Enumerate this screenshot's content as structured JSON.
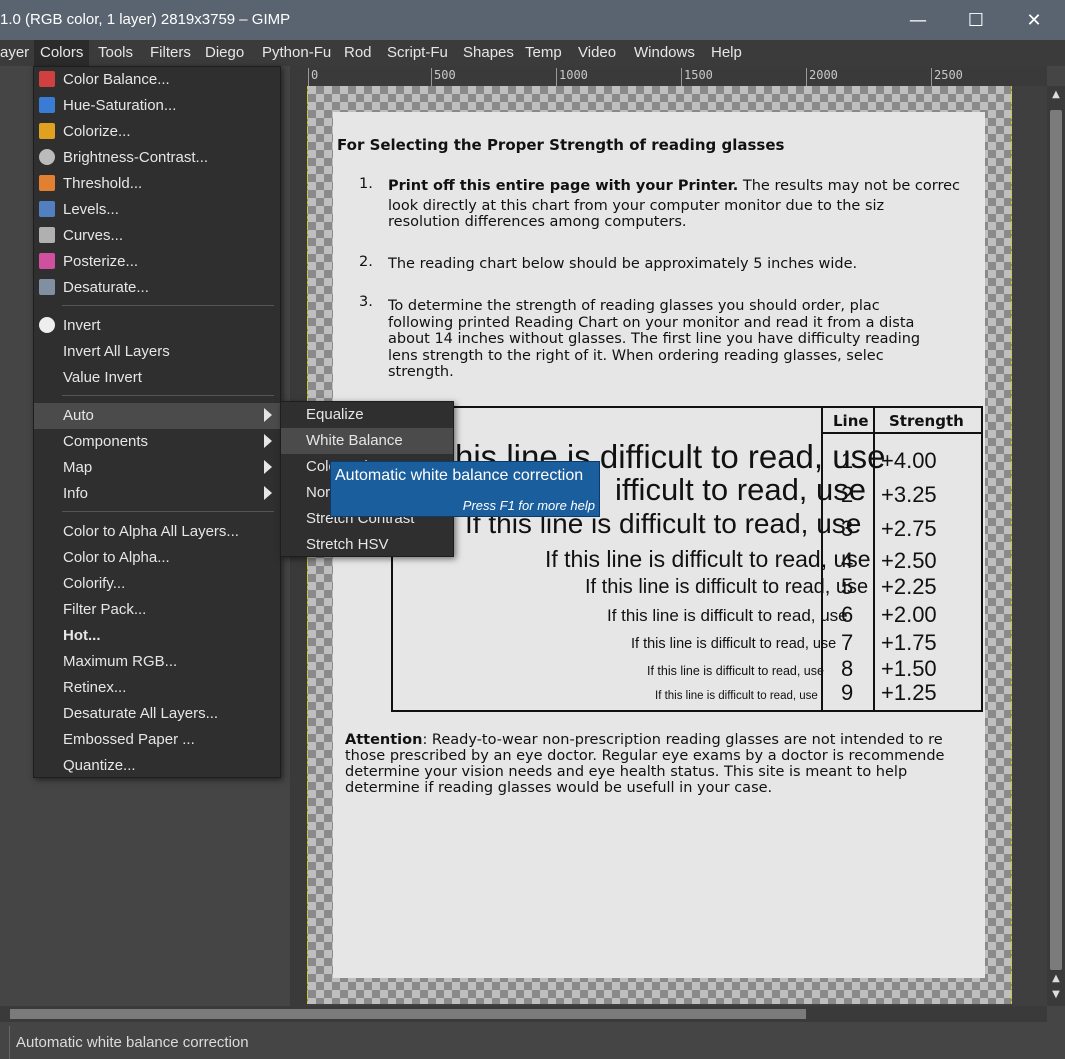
{
  "window": {
    "title": "1.0 (RGB color, 1 layer) 2819x3759 – GIMP",
    "minimize": "—",
    "maximize": "☐",
    "close": "✕"
  },
  "menubar": [
    {
      "label": "ayer"
    },
    {
      "label": "Colors",
      "active": true
    },
    {
      "label": "Tools"
    },
    {
      "label": "Filters"
    },
    {
      "label": "Diego"
    },
    {
      "label": "Python-Fu"
    },
    {
      "label": "Rod"
    },
    {
      "label": "Script-Fu"
    },
    {
      "label": "Shapes"
    },
    {
      "label": "Temp"
    },
    {
      "label": "Video"
    },
    {
      "label": "Windows"
    },
    {
      "label": "Help"
    }
  ],
  "ruler": {
    "ticks": [
      "0",
      "500",
      "1000",
      "1500",
      "2000",
      "2500"
    ]
  },
  "colors_menu": {
    "items": [
      {
        "label": "Color Balance...",
        "icon": "color-balance-icon",
        "icon_color": "#d04040"
      },
      {
        "label": "Hue-Saturation...",
        "icon": "hue-saturation-icon",
        "icon_color": "#3a7bd5"
      },
      {
        "label": "Colorize...",
        "icon": "colorize-icon",
        "icon_color": "#e0a020"
      },
      {
        "label": "Brightness-Contrast...",
        "icon": "brightness-contrast-icon",
        "icon_color": "#bbbbbb"
      },
      {
        "label": "Threshold...",
        "icon": "threshold-icon",
        "icon_color": "#e08030"
      },
      {
        "label": "Levels...",
        "icon": "levels-icon",
        "icon_color": "#5080c0"
      },
      {
        "label": "Curves...",
        "icon": "curves-icon",
        "icon_color": "#b0b0b0"
      },
      {
        "label": "Posterize...",
        "icon": "posterize-icon",
        "icon_color": "#d050a0"
      },
      {
        "label": "Desaturate...",
        "icon": "desaturate-icon",
        "icon_color": "#8090a0"
      },
      {
        "label": "Invert",
        "icon": "invert-icon",
        "icon_color": "#eeeeee"
      },
      {
        "label": "Invert All Layers"
      },
      {
        "label": "Value Invert"
      },
      {
        "label": "Auto",
        "submenu": true,
        "highlighted": true
      },
      {
        "label": "Components",
        "submenu": true
      },
      {
        "label": "Map",
        "submenu": true
      },
      {
        "label": "Info",
        "submenu": true
      },
      {
        "label": "Color to Alpha All Layers..."
      },
      {
        "label": "Color to Alpha..."
      },
      {
        "label": "Colorify..."
      },
      {
        "label": "Filter Pack..."
      },
      {
        "label": "Hot...",
        "bold": true
      },
      {
        "label": "Maximum RGB..."
      },
      {
        "label": "Retinex..."
      },
      {
        "label": "Desaturate All Layers..."
      },
      {
        "label": "Embossed Paper ..."
      },
      {
        "label": "Quantize..."
      }
    ]
  },
  "auto_submenu": {
    "items": [
      {
        "label": "Equalize"
      },
      {
        "label": "White Balance",
        "highlighted": true
      },
      {
        "label": "Color Enhance"
      },
      {
        "label": "Normalize"
      },
      {
        "label": "Stretch Contrast"
      },
      {
        "label": "Stretch HSV"
      }
    ]
  },
  "tooltip": {
    "title": "Automatic white balance correction",
    "hint": "Press F1 for more help"
  },
  "statusbar": {
    "text": "Automatic white balance correction"
  },
  "document": {
    "heading": "For Selecting the Proper Strength of reading glasses",
    "item1_bold": "Print off this entire page with your Printer.",
    "item1_rest": " The results may not be correc",
    "item1_l2": "look directly at this chart from your computer monitor due to the siz",
    "item1_l3": "resolution differences among computers.",
    "item2": "The reading chart below should be approximately 5 inches wide.",
    "item3_l1": "To determine the strength of reading glasses you should order, plac",
    "item3_l2": "following printed Reading Chart on your monitor and read it from a dista",
    "item3_l3": "about 14 inches without glasses. The first line you have difficulty reading",
    "item3_l4": "lens strength to the right of it. When ordering reading glasses, selec",
    "item3_l5": "strength.",
    "chart_header_line": "Line",
    "chart_header_strength": "Strength",
    "chart_rows": [
      {
        "text": "his line is difficult to read, use",
        "line": "1",
        "strength": "+4.00"
      },
      {
        "text": "ifficult to read, use",
        "line": "2",
        "strength": "+3.25"
      },
      {
        "text": "If this line is difficult to read, use",
        "line": "3",
        "strength": "+2.75"
      },
      {
        "text": "If this line is difficult to read, use",
        "line": "4",
        "strength": "+2.50"
      },
      {
        "text": "If this line is difficult to read, use",
        "line": "5",
        "strength": "+2.25"
      },
      {
        "text": "If this line is difficult to read, use",
        "line": "6",
        "strength": "+2.00"
      },
      {
        "text": "If this line is difficult to read, use",
        "line": "7",
        "strength": "+1.75"
      },
      {
        "text": "If this line is difficult to read, use",
        "line": "8",
        "strength": "+1.50"
      },
      {
        "text": "If this line is difficult to read, use",
        "line": "9",
        "strength": "+1.25"
      }
    ],
    "attention_label": "Attention",
    "attention_l1": ": Ready-to-wear non-prescription reading glasses are not intended to re",
    "attention_l2": "those prescribed by an eye doctor. Regular eye exams by a doctor is recommende",
    "attention_l3": "determine your vision needs and eye health status. This site is meant to help",
    "attention_l4": "determine if reading glasses would be usefull in your case."
  }
}
